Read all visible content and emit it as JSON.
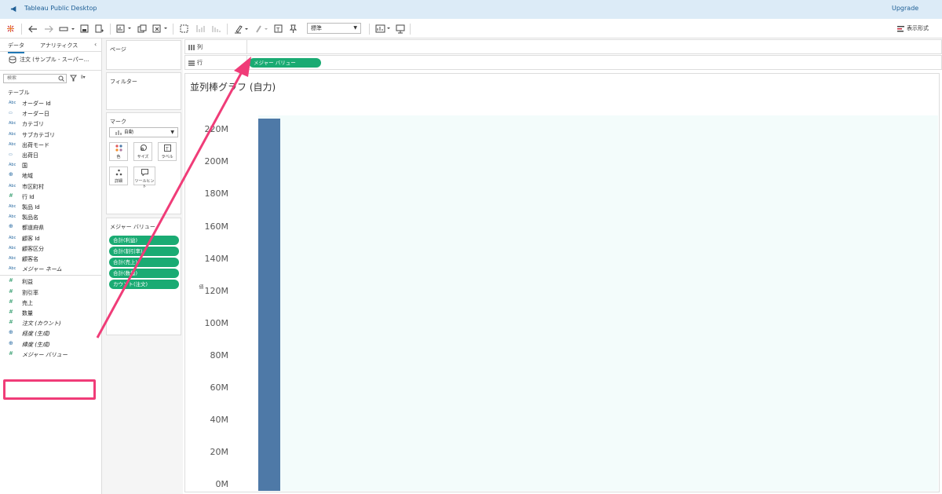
{
  "window": {
    "title": "Tableau Public Desktop",
    "upgrade_label": "Upgrade"
  },
  "toolbar": {
    "font_size_select": "標準",
    "show_me_label": "表示形式"
  },
  "data_pane": {
    "tabs": [
      "データ",
      "アナリティクス"
    ],
    "collapse": "‹",
    "datasource": "注文 (サンプル - スーパー...",
    "search_placeholder": "検索",
    "table_header": "テーブル",
    "fields": [
      {
        "type": "Abc",
        "label": "オーダー Id"
      },
      {
        "type": "date",
        "label": "オーダー日"
      },
      {
        "type": "Abc",
        "label": "カテゴリ"
      },
      {
        "type": "Abc",
        "label": "サブカテゴリ"
      },
      {
        "type": "Abc",
        "label": "出荷モード"
      },
      {
        "type": "date",
        "label": "出荷日"
      },
      {
        "type": "Abc",
        "label": "国"
      },
      {
        "type": "geo",
        "label": "地域"
      },
      {
        "type": "Abc",
        "label": "市区町村"
      },
      {
        "type": "num",
        "label": "行 Id"
      },
      {
        "type": "Abc",
        "label": "製品 Id"
      },
      {
        "type": "Abc",
        "label": "製品名"
      },
      {
        "type": "geo",
        "label": "都道府県"
      },
      {
        "type": "Abc",
        "label": "顧客 Id"
      },
      {
        "type": "Abc",
        "label": "顧客区分"
      },
      {
        "type": "Abc",
        "label": "顧客名"
      },
      {
        "type": "Abc",
        "label": "メジャー ネーム",
        "italic": true
      }
    ],
    "measures": [
      {
        "type": "num",
        "label": "利益"
      },
      {
        "type": "num",
        "label": "割引率"
      },
      {
        "type": "num",
        "label": "売上"
      },
      {
        "type": "num",
        "label": "数量"
      },
      {
        "type": "num",
        "label": "注文 (カウント)",
        "italic": true
      },
      {
        "type": "geo",
        "label": "経度 (生成)",
        "italic": true
      },
      {
        "type": "geo",
        "label": "緯度 (生成)",
        "italic": true
      },
      {
        "type": "num",
        "label": "メジャー バリュー",
        "italic": true
      }
    ]
  },
  "cards": {
    "pages": "ページ",
    "filters": "フィルター",
    "marks": {
      "title": "マーク",
      "type": "自動",
      "buttons": [
        "色",
        "サイズ",
        "ラベル",
        "詳細",
        "ツールヒント"
      ]
    },
    "measure_values": {
      "title": "メジャー バリュー",
      "pills": [
        "合計(利益)",
        "合計(割引率)",
        "合計(売上)",
        "合計(数量)",
        "カウント(注文)"
      ]
    }
  },
  "shelves": {
    "columns_label": "列",
    "rows_label": "行",
    "rows_pill": "メジャー バリュー"
  },
  "view": {
    "title": "並列棒グラフ (自力)",
    "y_axis_name": "値"
  },
  "chart_data": {
    "type": "bar",
    "categories": [
      ""
    ],
    "values": [
      227000000
    ],
    "ylabel": "値",
    "ylim": [
      0,
      227000000
    ],
    "yticks": [
      "0M",
      "20M",
      "40M",
      "60M",
      "80M",
      "100M",
      "120M",
      "140M",
      "160M",
      "180M",
      "200M",
      "220M"
    ],
    "bar_color": "#4e79a7"
  },
  "colors": {
    "accent_pill": "#1aab73",
    "highlight": "#f03c78",
    "plot_bg": "#f3fcfb"
  }
}
